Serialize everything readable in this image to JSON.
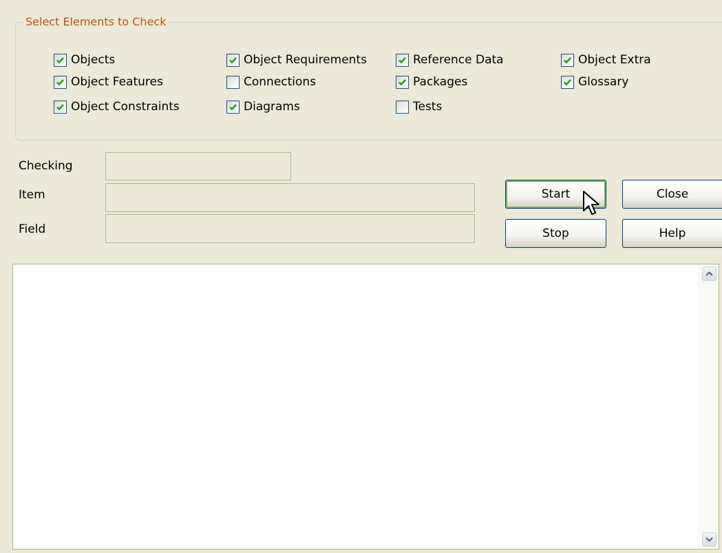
{
  "group": {
    "title": "Select Elements to Check",
    "checkboxes": [
      {
        "label": "Objects",
        "checked": true
      },
      {
        "label": "Object Features",
        "checked": true
      },
      {
        "label": "Object Constraints",
        "checked": true
      },
      {
        "label": "Object Requirements",
        "checked": true
      },
      {
        "label": "Connections",
        "checked": false
      },
      {
        "label": "Diagrams",
        "checked": true
      },
      {
        "label": "Reference Data",
        "checked": true
      },
      {
        "label": "Packages",
        "checked": true
      },
      {
        "label": "Tests",
        "checked": false
      },
      {
        "label": "Object Extra",
        "checked": true
      },
      {
        "label": "Glossary",
        "checked": true
      }
    ]
  },
  "fields": {
    "checking_label": "Checking",
    "checking_value": "",
    "item_label": "Item",
    "item_value": "",
    "field_label": "Field",
    "field_value": ""
  },
  "buttons": {
    "start": "Start",
    "stop": "Stop",
    "close": "Close",
    "help": "Help"
  },
  "output": {
    "text": ""
  },
  "colors": {
    "dialog_bg": "#ece9d8",
    "group_title": "#b8560f",
    "check_mark": "#21a121",
    "field_border": "#a5bf84",
    "default_button_glow": "#7bb35a"
  },
  "icons": {
    "scroll_up": "chevron-up-icon",
    "scroll_down": "chevron-down-icon",
    "cursor": "mouse-pointer-icon"
  }
}
